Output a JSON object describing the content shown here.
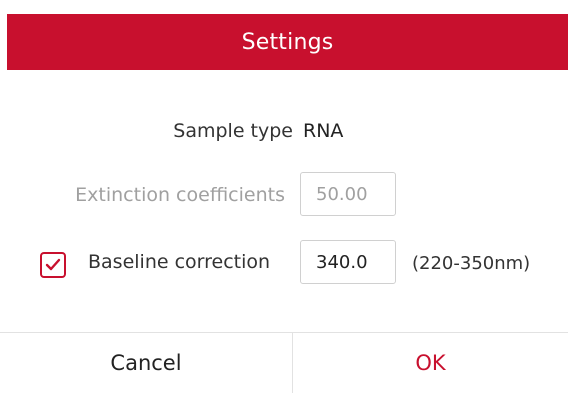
{
  "dialog": {
    "title": "Settings"
  },
  "sample_type": {
    "label": "Sample type",
    "value": "RNA"
  },
  "extinction": {
    "label": "Extinction coefficients",
    "value": "50.00",
    "enabled": false
  },
  "baseline": {
    "checked": true,
    "label": "Baseline correction",
    "value": "340.0",
    "range": "(220-350nm)"
  },
  "buttons": {
    "cancel": "Cancel",
    "ok": "OK"
  },
  "colors": {
    "accent": "#c8102e",
    "disabled_text": "#a0a0a0",
    "border": "#d0d0d0"
  },
  "icons": {
    "checkbox": "checkmark-icon"
  }
}
